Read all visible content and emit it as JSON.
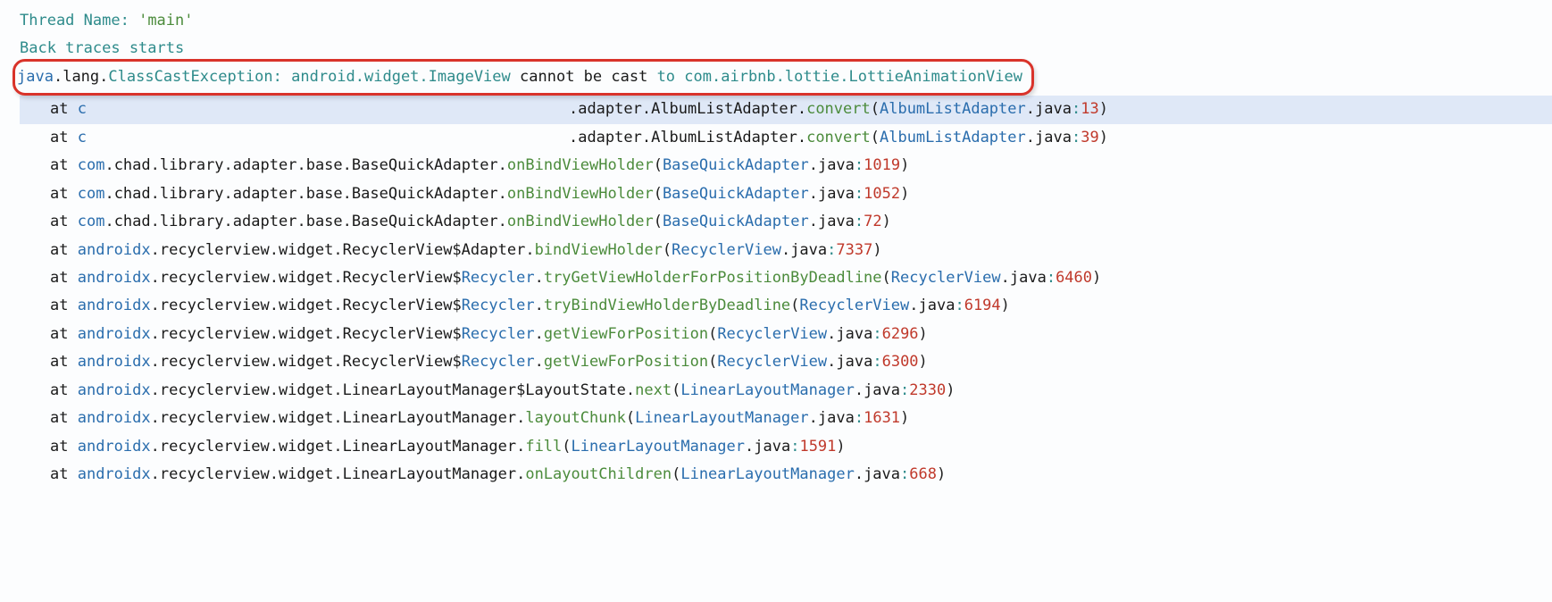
{
  "header": {
    "thread_name_label": "Thread Name:",
    "thread_name_value": "'main'",
    "back_traces": "Back traces starts"
  },
  "exception": {
    "pkg1": "java",
    "pkg2": "lang",
    "cls": "ClassCastException",
    "msg_pkg": "android.widget.ImageView",
    "msg_mid": "cannot be cast",
    "msg_to": "to",
    "msg_tgt": "com.airbnb.lottie.LottieAnimationView"
  },
  "frames": [
    {
      "at": "at",
      "redacted": true,
      "suffix": ".adapter.AlbumListAdapter.",
      "method": "convert",
      "file": "AlbumListAdapter",
      "ext": "java",
      "line": "13",
      "hl": true
    },
    {
      "at": "at",
      "redacted": true,
      "suffix": ".adapter.AlbumListAdapter.",
      "method": "convert",
      "file": "AlbumListAdapter",
      "ext": "java",
      "line": "39"
    },
    {
      "at": "at",
      "parts": [
        {
          "t": "com",
          "c": "blue"
        },
        {
          "t": ".",
          "c": "punct"
        },
        {
          "t": "chad",
          "c": "black"
        },
        {
          "t": ".",
          "c": "punct"
        },
        {
          "t": "library",
          "c": "black"
        },
        {
          "t": ".",
          "c": "punct"
        },
        {
          "t": "adapter",
          "c": "black"
        },
        {
          "t": ".",
          "c": "punct"
        },
        {
          "t": "base",
          "c": "black"
        },
        {
          "t": ".",
          "c": "punct"
        },
        {
          "t": "BaseQuickAdapter",
          "c": "black"
        },
        {
          "t": ".",
          "c": "punct"
        },
        {
          "t": "onBindViewHolder",
          "c": "green"
        }
      ],
      "file": "BaseQuickAdapter",
      "ext": "java",
      "line": "1019"
    },
    {
      "at": "at",
      "parts": [
        {
          "t": "com",
          "c": "blue"
        },
        {
          "t": ".",
          "c": "punct"
        },
        {
          "t": "chad",
          "c": "black"
        },
        {
          "t": ".",
          "c": "punct"
        },
        {
          "t": "library",
          "c": "black"
        },
        {
          "t": ".",
          "c": "punct"
        },
        {
          "t": "adapter",
          "c": "black"
        },
        {
          "t": ".",
          "c": "punct"
        },
        {
          "t": "base",
          "c": "black"
        },
        {
          "t": ".",
          "c": "punct"
        },
        {
          "t": "BaseQuickAdapter",
          "c": "black"
        },
        {
          "t": ".",
          "c": "punct"
        },
        {
          "t": "onBindViewHolder",
          "c": "green"
        }
      ],
      "file": "BaseQuickAdapter",
      "ext": "java",
      "line": "1052"
    },
    {
      "at": "at",
      "parts": [
        {
          "t": "com",
          "c": "blue"
        },
        {
          "t": ".",
          "c": "punct"
        },
        {
          "t": "chad",
          "c": "black"
        },
        {
          "t": ".",
          "c": "punct"
        },
        {
          "t": "library",
          "c": "black"
        },
        {
          "t": ".",
          "c": "punct"
        },
        {
          "t": "adapter",
          "c": "black"
        },
        {
          "t": ".",
          "c": "punct"
        },
        {
          "t": "base",
          "c": "black"
        },
        {
          "t": ".",
          "c": "punct"
        },
        {
          "t": "BaseQuickAdapter",
          "c": "black"
        },
        {
          "t": ".",
          "c": "punct"
        },
        {
          "t": "onBindViewHolder",
          "c": "green"
        }
      ],
      "file": "BaseQuickAdapter",
      "ext": "java",
      "line": "72"
    },
    {
      "at": "at",
      "parts": [
        {
          "t": "androidx",
          "c": "blue"
        },
        {
          "t": ".",
          "c": "punct"
        },
        {
          "t": "recyclerview",
          "c": "black"
        },
        {
          "t": ".",
          "c": "punct"
        },
        {
          "t": "widget",
          "c": "black"
        },
        {
          "t": ".",
          "c": "punct"
        },
        {
          "t": "RecyclerView$Adapter",
          "c": "black"
        },
        {
          "t": ".",
          "c": "punct"
        },
        {
          "t": "bindViewHolder",
          "c": "green"
        }
      ],
      "file": "RecyclerView",
      "ext": "java",
      "line": "7337"
    },
    {
      "at": "at",
      "parts": [
        {
          "t": "androidx",
          "c": "blue"
        },
        {
          "t": ".",
          "c": "punct"
        },
        {
          "t": "recyclerview",
          "c": "black"
        },
        {
          "t": ".",
          "c": "punct"
        },
        {
          "t": "widget",
          "c": "black"
        },
        {
          "t": ".",
          "c": "punct"
        },
        {
          "t": "RecyclerView",
          "c": "black"
        },
        {
          "t": "$",
          "c": "black"
        },
        {
          "t": "Recycler",
          "c": "blue"
        },
        {
          "t": ".",
          "c": "punct"
        },
        {
          "t": "tryGetViewHolderForPositionByDeadline",
          "c": "green"
        }
      ],
      "file": "RecyclerView",
      "ext": "java",
      "line": "6460"
    },
    {
      "at": "at",
      "parts": [
        {
          "t": "androidx",
          "c": "blue"
        },
        {
          "t": ".",
          "c": "punct"
        },
        {
          "t": "recyclerview",
          "c": "black"
        },
        {
          "t": ".",
          "c": "punct"
        },
        {
          "t": "widget",
          "c": "black"
        },
        {
          "t": ".",
          "c": "punct"
        },
        {
          "t": "RecyclerView",
          "c": "black"
        },
        {
          "t": "$",
          "c": "black"
        },
        {
          "t": "Recycler",
          "c": "blue"
        },
        {
          "t": ".",
          "c": "punct"
        },
        {
          "t": "tryBindViewHolderByDeadline",
          "c": "green"
        }
      ],
      "file": "RecyclerView",
      "ext": "java",
      "line": "6194"
    },
    {
      "at": "at",
      "parts": [
        {
          "t": "androidx",
          "c": "blue"
        },
        {
          "t": ".",
          "c": "punct"
        },
        {
          "t": "recyclerview",
          "c": "black"
        },
        {
          "t": ".",
          "c": "punct"
        },
        {
          "t": "widget",
          "c": "black"
        },
        {
          "t": ".",
          "c": "punct"
        },
        {
          "t": "RecyclerView",
          "c": "black"
        },
        {
          "t": "$",
          "c": "black"
        },
        {
          "t": "Recycler",
          "c": "blue"
        },
        {
          "t": ".",
          "c": "punct"
        },
        {
          "t": "getViewForPosition",
          "c": "green"
        }
      ],
      "file": "RecyclerView",
      "ext": "java",
      "line": "6296"
    },
    {
      "at": "at",
      "parts": [
        {
          "t": "androidx",
          "c": "blue"
        },
        {
          "t": ".",
          "c": "punct"
        },
        {
          "t": "recyclerview",
          "c": "black"
        },
        {
          "t": ".",
          "c": "punct"
        },
        {
          "t": "widget",
          "c": "black"
        },
        {
          "t": ".",
          "c": "punct"
        },
        {
          "t": "RecyclerView",
          "c": "black"
        },
        {
          "t": "$",
          "c": "black"
        },
        {
          "t": "Recycler",
          "c": "blue"
        },
        {
          "t": ".",
          "c": "punct"
        },
        {
          "t": "getViewForPosition",
          "c": "green"
        }
      ],
      "file": "RecyclerView",
      "ext": "java",
      "line": "6300"
    },
    {
      "at": "at",
      "parts": [
        {
          "t": "androidx",
          "c": "blue"
        },
        {
          "t": ".",
          "c": "punct"
        },
        {
          "t": "recyclerview",
          "c": "black"
        },
        {
          "t": ".",
          "c": "punct"
        },
        {
          "t": "widget",
          "c": "black"
        },
        {
          "t": ".",
          "c": "punct"
        },
        {
          "t": "LinearLayoutManager$LayoutState",
          "c": "black"
        },
        {
          "t": ".",
          "c": "punct"
        },
        {
          "t": "next",
          "c": "green"
        }
      ],
      "file": "LinearLayoutManager",
      "ext": "java",
      "line": "2330"
    },
    {
      "at": "at",
      "parts": [
        {
          "t": "androidx",
          "c": "blue"
        },
        {
          "t": ".",
          "c": "punct"
        },
        {
          "t": "recyclerview",
          "c": "black"
        },
        {
          "t": ".",
          "c": "punct"
        },
        {
          "t": "widget",
          "c": "black"
        },
        {
          "t": ".",
          "c": "punct"
        },
        {
          "t": "LinearLayoutManager",
          "c": "black"
        },
        {
          "t": ".",
          "c": "punct"
        },
        {
          "t": "layoutChunk",
          "c": "green"
        }
      ],
      "file": "LinearLayoutManager",
      "ext": "java",
      "line": "1631"
    },
    {
      "at": "at",
      "parts": [
        {
          "t": "androidx",
          "c": "blue"
        },
        {
          "t": ".",
          "c": "punct"
        },
        {
          "t": "recyclerview",
          "c": "black"
        },
        {
          "t": ".",
          "c": "punct"
        },
        {
          "t": "widget",
          "c": "black"
        },
        {
          "t": ".",
          "c": "punct"
        },
        {
          "t": "LinearLayoutManager",
          "c": "black"
        },
        {
          "t": ".",
          "c": "punct"
        },
        {
          "t": "fill",
          "c": "green"
        }
      ],
      "file": "LinearLayoutManager",
      "ext": "java",
      "line": "1591"
    },
    {
      "at": "at",
      "parts": [
        {
          "t": "androidx",
          "c": "blue"
        },
        {
          "t": ".",
          "c": "punct"
        },
        {
          "t": "recyclerview",
          "c": "black"
        },
        {
          "t": ".",
          "c": "punct"
        },
        {
          "t": "widget",
          "c": "black"
        },
        {
          "t": ".",
          "c": "punct"
        },
        {
          "t": "LinearLayoutManager",
          "c": "black"
        },
        {
          "t": ".",
          "c": "punct"
        },
        {
          "t": "onLayoutChildren",
          "c": "green"
        }
      ],
      "file": "LinearLayoutManager",
      "ext": "java",
      "line": "668"
    }
  ]
}
